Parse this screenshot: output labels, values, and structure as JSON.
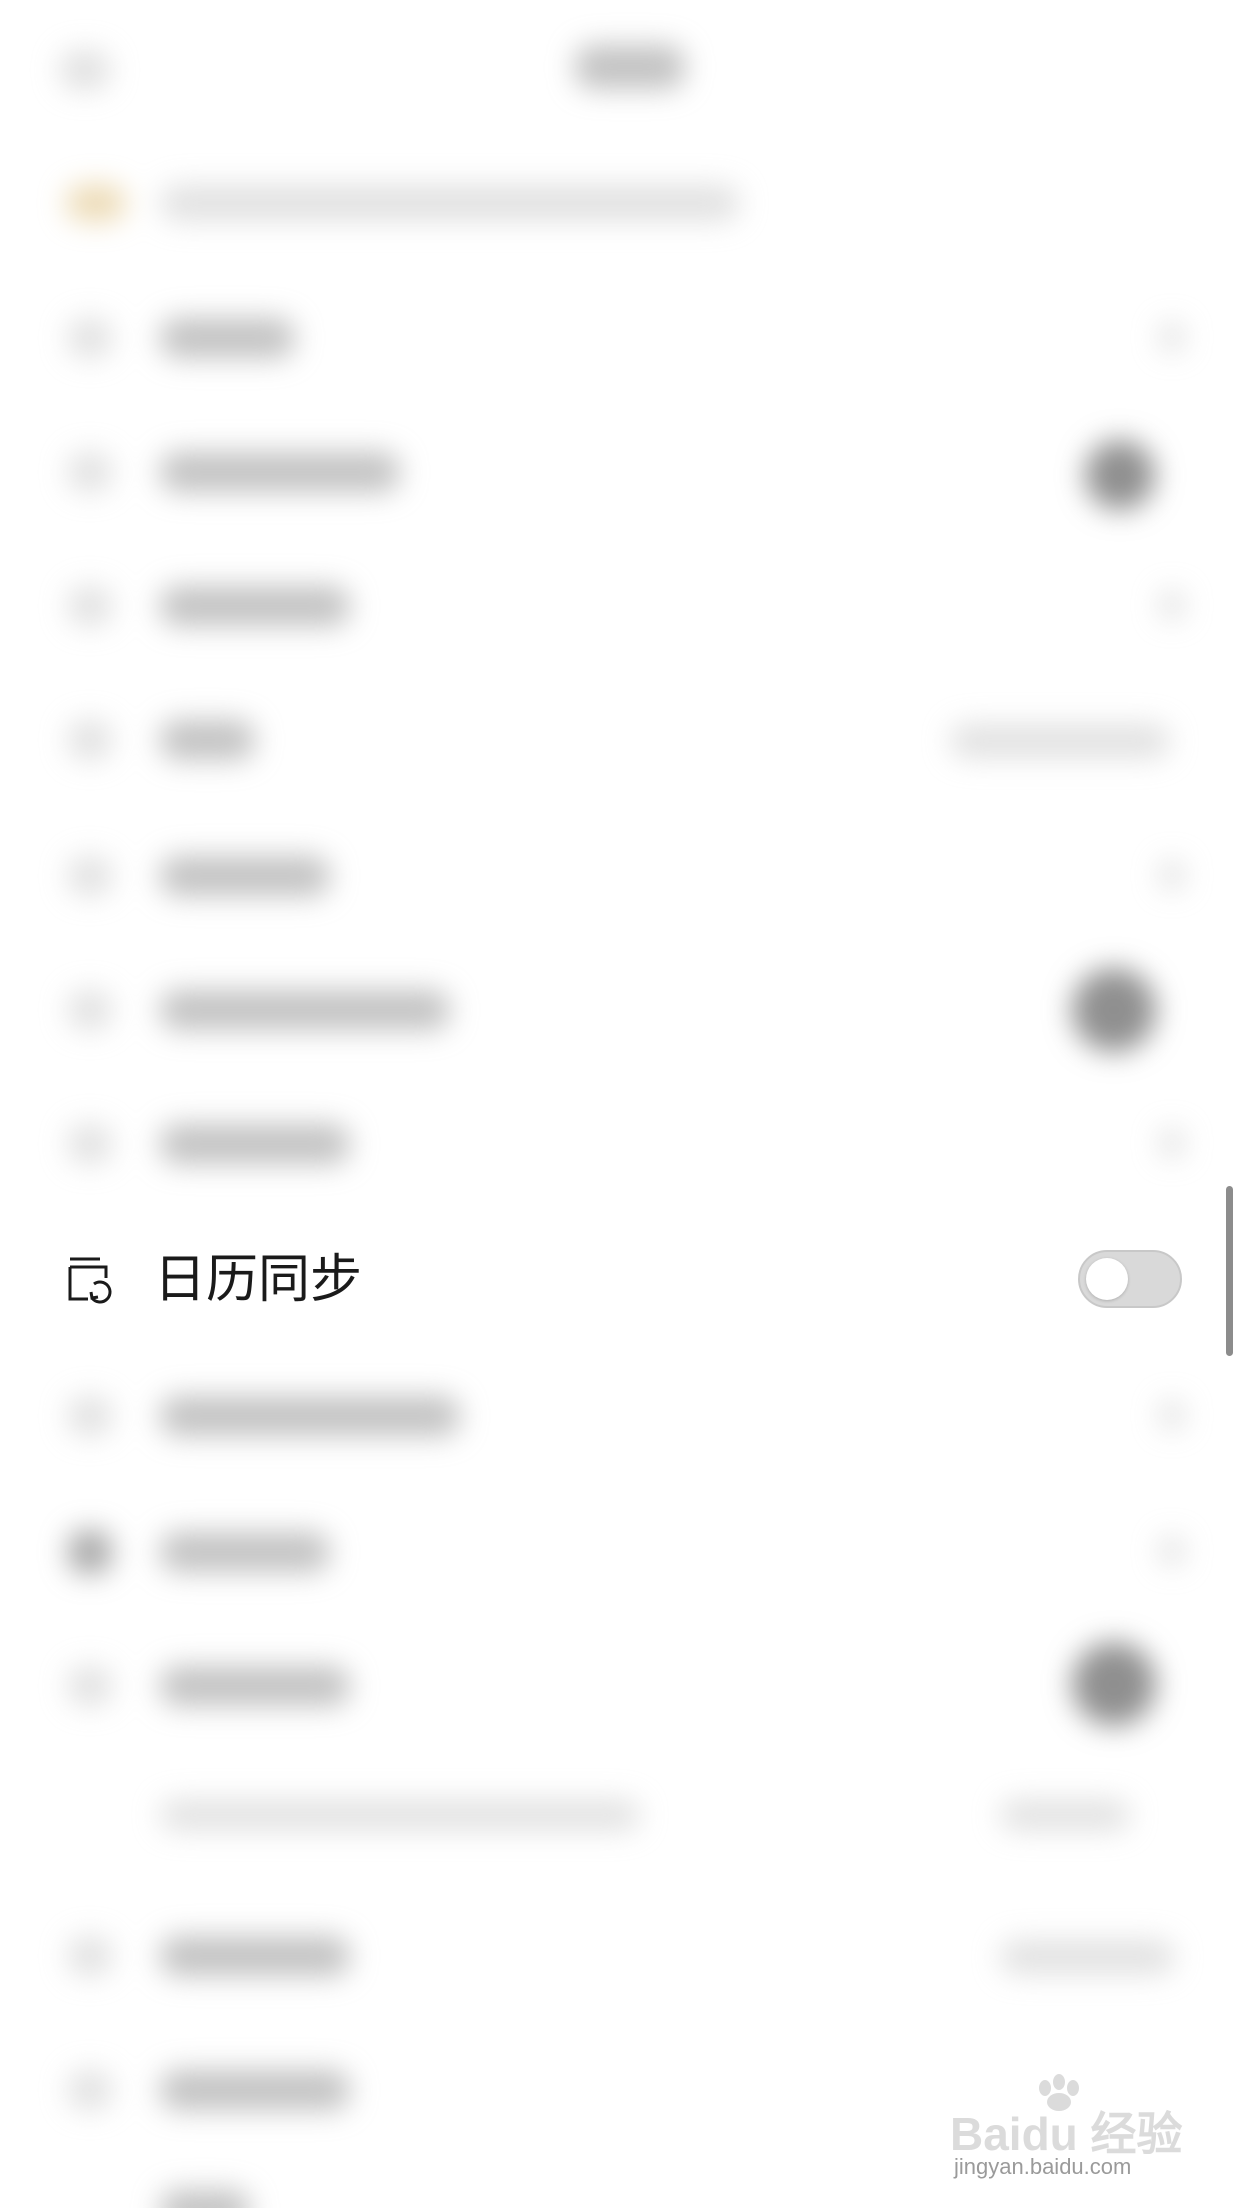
{
  "calendar_sync": {
    "label": "日历同步",
    "enabled": false,
    "icon": "calendar-sync-icon"
  },
  "watermark": {
    "logo_text": "Baidu 经验",
    "url_text": "jingyan.baidu.com"
  },
  "colors": {
    "background": "#ffffff",
    "label_text": "#1a1a1a",
    "toggle_off_track": "#d9d9d9",
    "scrollbar": "#8c8c8c"
  }
}
